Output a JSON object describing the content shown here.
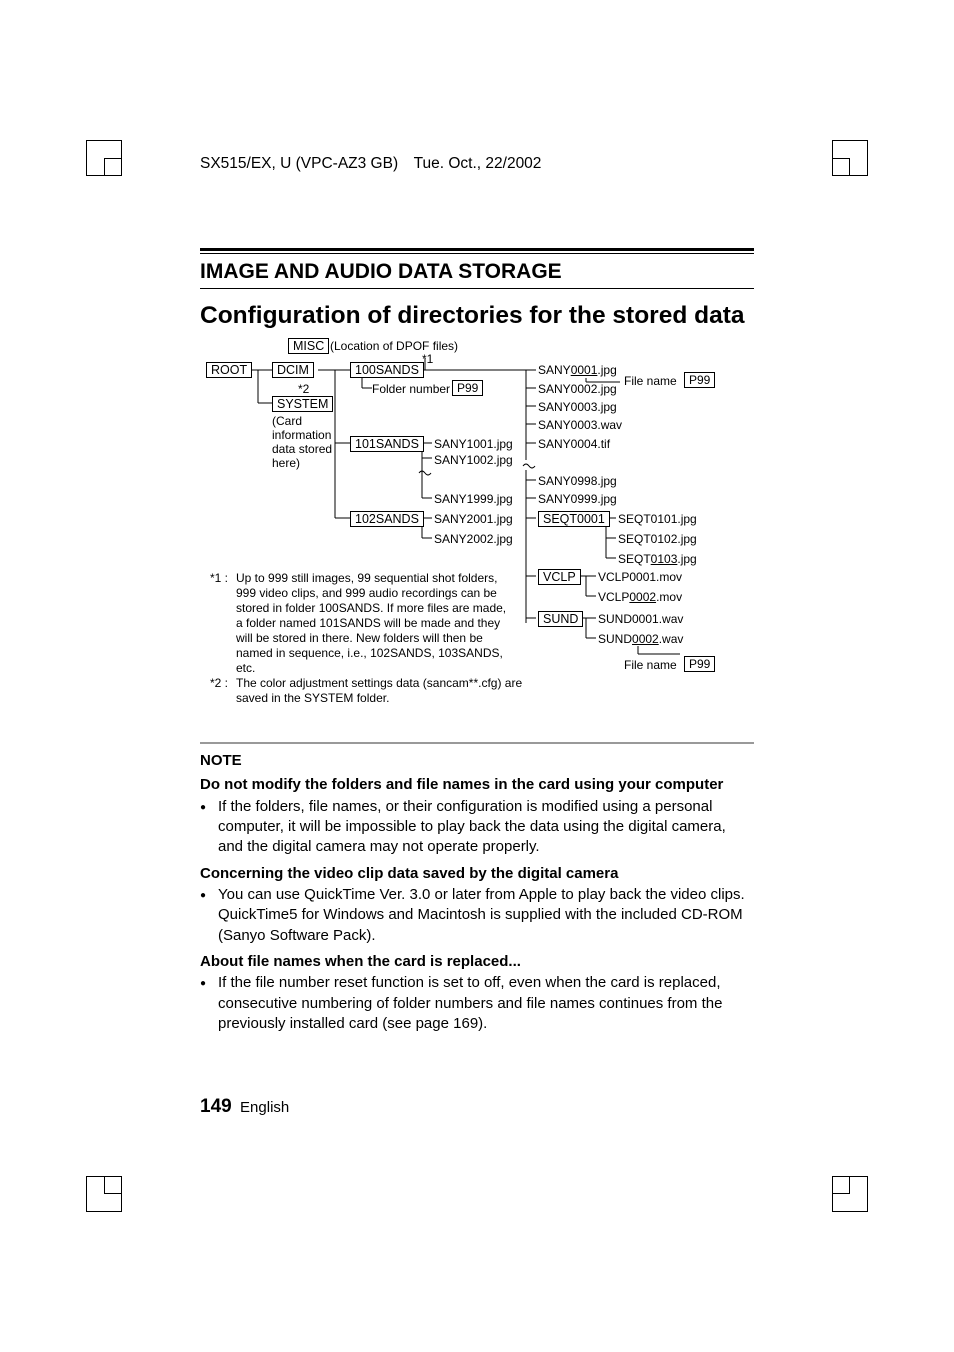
{
  "header": "SX515/EX, U (VPC-AZ3 GB) Tue. Oct., 22/2002",
  "section": "IMAGE AND AUDIO DATA STORAGE",
  "subtitle": "Configuration of directories for the stored data",
  "diagram": {
    "misc": "MISC",
    "misc_caption": "(Location of DPOF files)",
    "root": "ROOT",
    "dcim": "DCIM",
    "system": "SYSTEM",
    "system_caption_l1": "(Card",
    "system_caption_l2": "information",
    "system_caption_l3": "data stored",
    "system_caption_l4": "here)",
    "star1": "*1",
    "star2": "*2",
    "folder_100": "100SANDS",
    "folder_number": "Folder number",
    "p99": "P99",
    "folder_101": "101SANDS",
    "f101_a": "SANY1001.jpg",
    "f101_b": "SANY1002.jpg",
    "f101_c": "SANY1999.jpg",
    "folder_102": "102SANDS",
    "f102_a": "SANY2001.jpg",
    "f102_b": "SANY2002.jpg",
    "c1": "SANY0001.jpg",
    "c1_u": "0001",
    "c1_pre": "SANY",
    "c1_suf": ".jpg",
    "c2": "SANY0002.jpg",
    "c3": "SANY0003.jpg",
    "c4": "SANY0003.wav",
    "c5": "SANY0004.tif",
    "c6": "SANY0998.jpg",
    "c7": "SANY0999.jpg",
    "filename_lbl": "File name",
    "seqt": "SEQT0001",
    "seqt_a_pre": "SEQT0101.jpg",
    "seqt_b": "SEQT0102.jpg",
    "seqt_c_pre": "SEQT",
    "seqt_c_u": "0103",
    "seqt_c_suf": ".jpg",
    "vclp": "VCLP",
    "vclp_a": "VCLP0001.mov",
    "vclp_b_pre": "VCLP",
    "vclp_b_u": "0002",
    "vclp_b_suf": ".mov",
    "sund": "SUND",
    "sund_a": "SUND0001.wav",
    "sund_b_pre": "SUND",
    "sund_b_u": "0002",
    "sund_b_suf": ".wav",
    "note1_label": "*1 :",
    "note1": "Up to 999 still images, 99 sequential shot folders, 999 video clips, and 999 audio recordings can be stored in folder 100SANDS. If more files are made, a folder named 101SANDS will be made and they will be stored in there. New folders will then be named in sequence, i.e., 102SANDS, 103SANDS, etc.",
    "note2_label": "*2 :",
    "note2": "The color adjustment settings data (sancam**.cfg) are saved in the SYSTEM folder."
  },
  "note": {
    "title": "NOTE",
    "h1": "Do not modify the folders and file names in the card using your computer",
    "b1": "If the folders, file names, or their configuration is modified using a personal computer, it will be impossible to play back the data using the digital camera, and the digital camera may not operate properly.",
    "h2": "Concerning the video clip data saved by the digital camera",
    "b2": "You can use QuickTime Ver. 3.0 or later from Apple to play back the video clips.",
    "b2c": "QuickTime5 for Windows and Macintosh is supplied with the included CD-ROM (Sanyo Software Pack).",
    "h3": "About file names when the card is replaced...",
    "b3": "If the file number reset function is set to off, even when the card is replaced, consecutive numbering of folder numbers and file names continues from the previously installed card (see page 169)."
  },
  "footer": {
    "page": "149",
    "lang": "English"
  }
}
